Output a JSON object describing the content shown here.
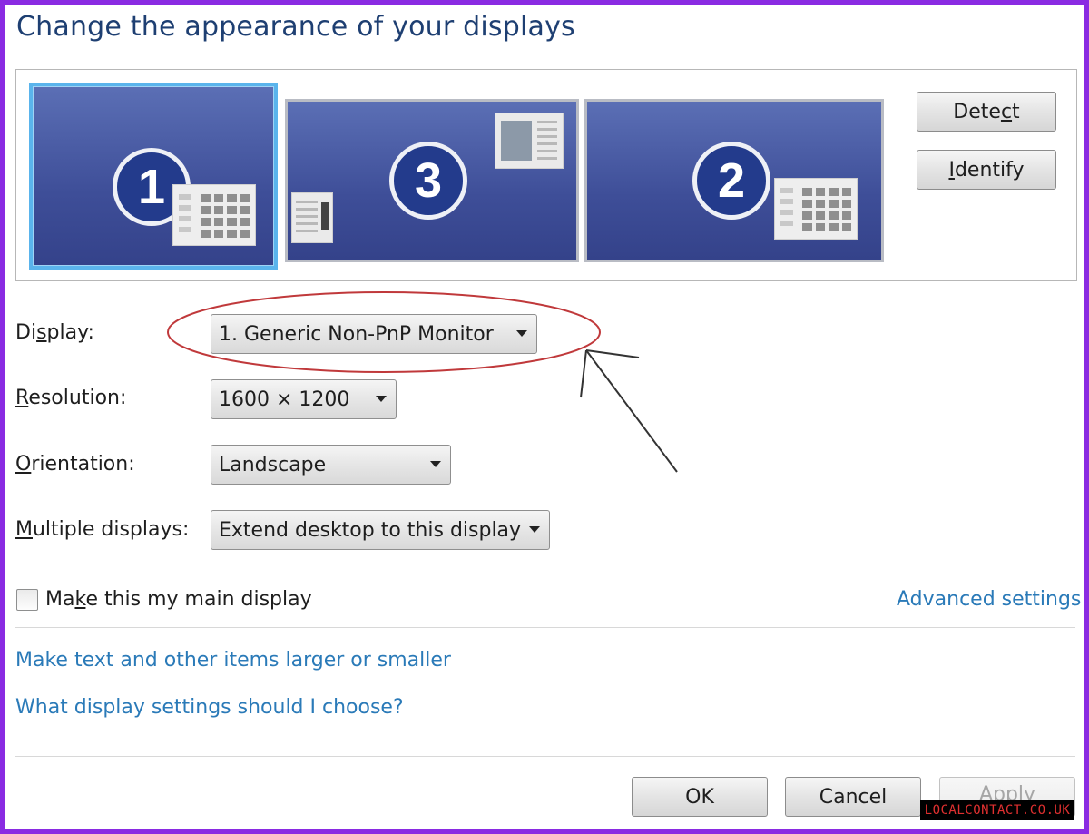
{
  "window": {
    "title": "Change the appearance of your displays"
  },
  "monitors": [
    {
      "number": "1",
      "selected": true
    },
    {
      "number": "3",
      "selected": false
    },
    {
      "number": "2",
      "selected": false
    }
  ],
  "buttons": {
    "detect": {
      "pre": "Dete",
      "accel": "c",
      "post": "t"
    },
    "identify": {
      "pre": "",
      "accel": "I",
      "post": "dentify"
    },
    "ok": "OK",
    "cancel": "Cancel",
    "apply": "Apply"
  },
  "fields": {
    "display": {
      "label_pre": "Di",
      "label_accel": "s",
      "label_post": "play:",
      "value": "1. Generic Non-PnP Monitor"
    },
    "resolution": {
      "label_pre": "",
      "label_accel": "R",
      "label_post": "esolution:",
      "value": "1600 × 1200"
    },
    "orientation": {
      "label_pre": "",
      "label_accel": "O",
      "label_post": "rientation:",
      "value": "Landscape"
    },
    "multiple_displays": {
      "label_pre": "",
      "label_accel": "M",
      "label_post": "ultiple displays:",
      "value": "Extend desktop to this display"
    }
  },
  "main_display": {
    "label_pre": "Ma",
    "label_accel": "k",
    "label_post": "e this my main display",
    "checked": false
  },
  "links": {
    "advanced_settings": "Advanced settings",
    "text_size": "Make text and other items larger or smaller",
    "help": "What display settings should I choose?"
  },
  "watermark": "LOCALCONTACT.CO.UK",
  "colors": {
    "border_accent": "#8a2be2",
    "link": "#2a7ab8",
    "title": "#1e3f72",
    "annotation_ellipse": "#c0393b",
    "monitor_blue": "#3e4e98"
  }
}
